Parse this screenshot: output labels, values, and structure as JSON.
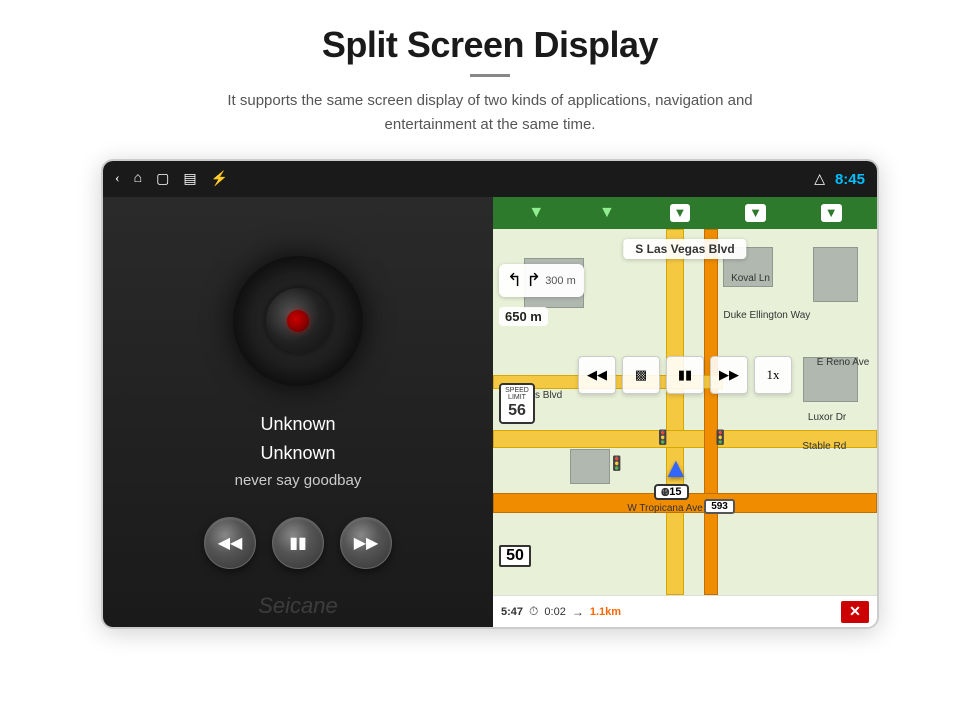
{
  "page": {
    "title": "Split Screen Display",
    "divider": "—",
    "subtitle": "It supports the same screen display of two kinds of applications, navigation and entertainment at the same time."
  },
  "status_bar": {
    "time": "8:45",
    "icons": [
      "back-icon",
      "home-icon",
      "app-icon",
      "image-icon",
      "usb-icon",
      "triangle-icon"
    ]
  },
  "music_player": {
    "track_title": "Unknown",
    "track_artist": "Unknown",
    "track_album": "never say goodbay",
    "controls": {
      "prev_label": "⏮",
      "play_label": "⏸",
      "next_label": "⏭"
    },
    "watermark": "Seicane"
  },
  "navigation": {
    "street_name": "S Las Vegas Blvd",
    "turn_distance": "300 m",
    "distance_label": "650 m",
    "speed_limit": "56",
    "speed_current": "50",
    "nav_arrows": [
      "↓",
      "↓",
      "↓",
      "↓",
      "↓"
    ],
    "map_labels": [
      "Koval Ln",
      "Duke Ellington Way",
      "Luxor Dr",
      "Stable Rd",
      "W Tropicana Ave",
      "E Reno Ave",
      "Vegas Blvd"
    ],
    "media_controls": [
      "⏮",
      "⊞",
      "⏸",
      "⏭",
      "1x"
    ],
    "bottom_bar": {
      "time": "5:47",
      "duration": "0:02",
      "distance": "1.1km"
    },
    "highway_badge": "15",
    "highway_badge2": "593"
  }
}
